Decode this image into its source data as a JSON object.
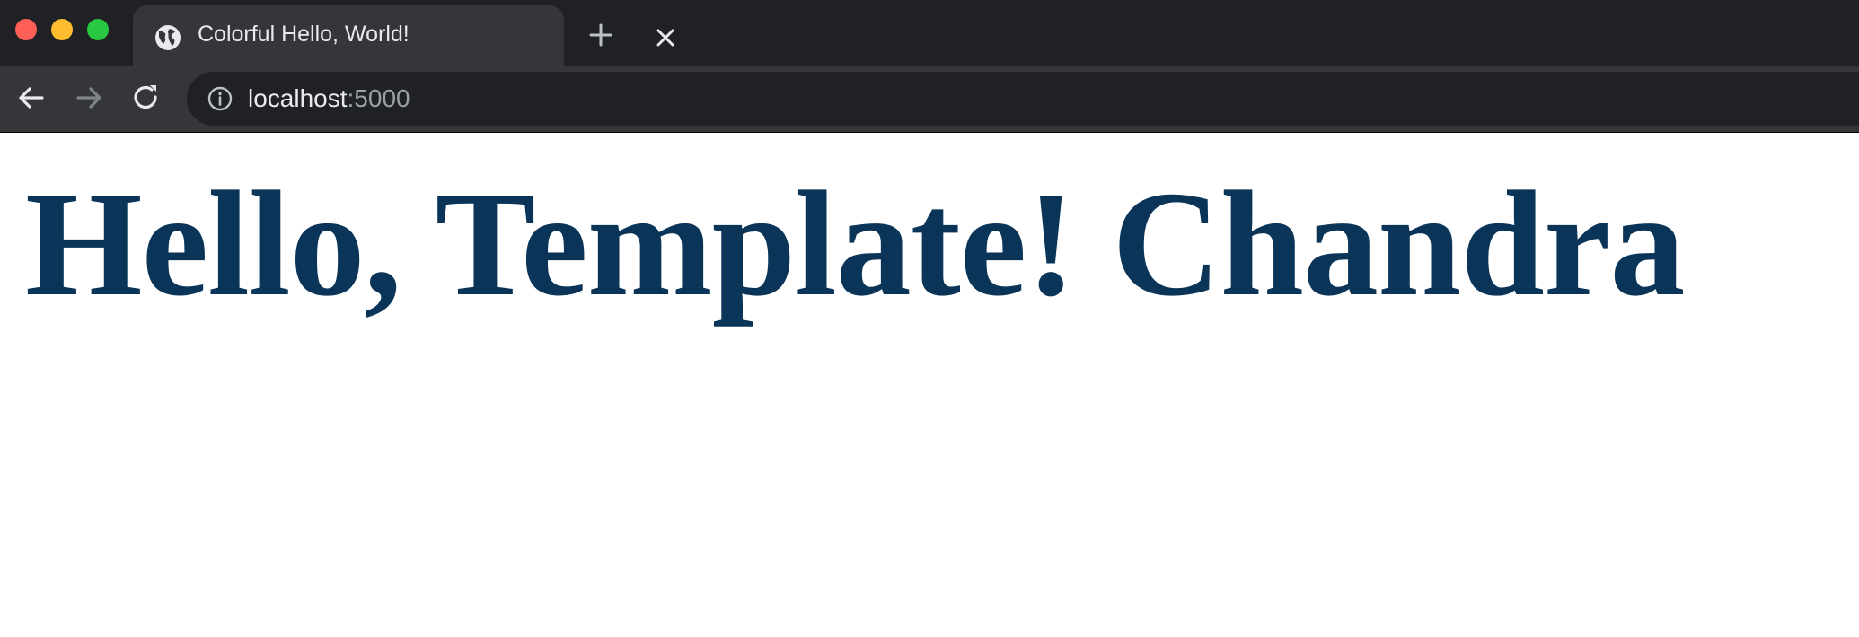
{
  "window": {
    "traffic_lights": {
      "close_color": "#ff5f57",
      "minimize_color": "#febc2e",
      "maximize_color": "#28c840"
    }
  },
  "tab": {
    "title": "Colorful Hello, World!",
    "favicon": "globe-icon"
  },
  "toolbar": {
    "back_icon": "arrow-left-icon",
    "forward_icon": "arrow-right-icon",
    "reload_icon": "reload-icon"
  },
  "address_bar": {
    "info_icon": "info-icon",
    "host": "localhost",
    "port": ":5000"
  },
  "page": {
    "heading": "Hello, Template! Chandra",
    "heading_color": "#0a3558"
  }
}
